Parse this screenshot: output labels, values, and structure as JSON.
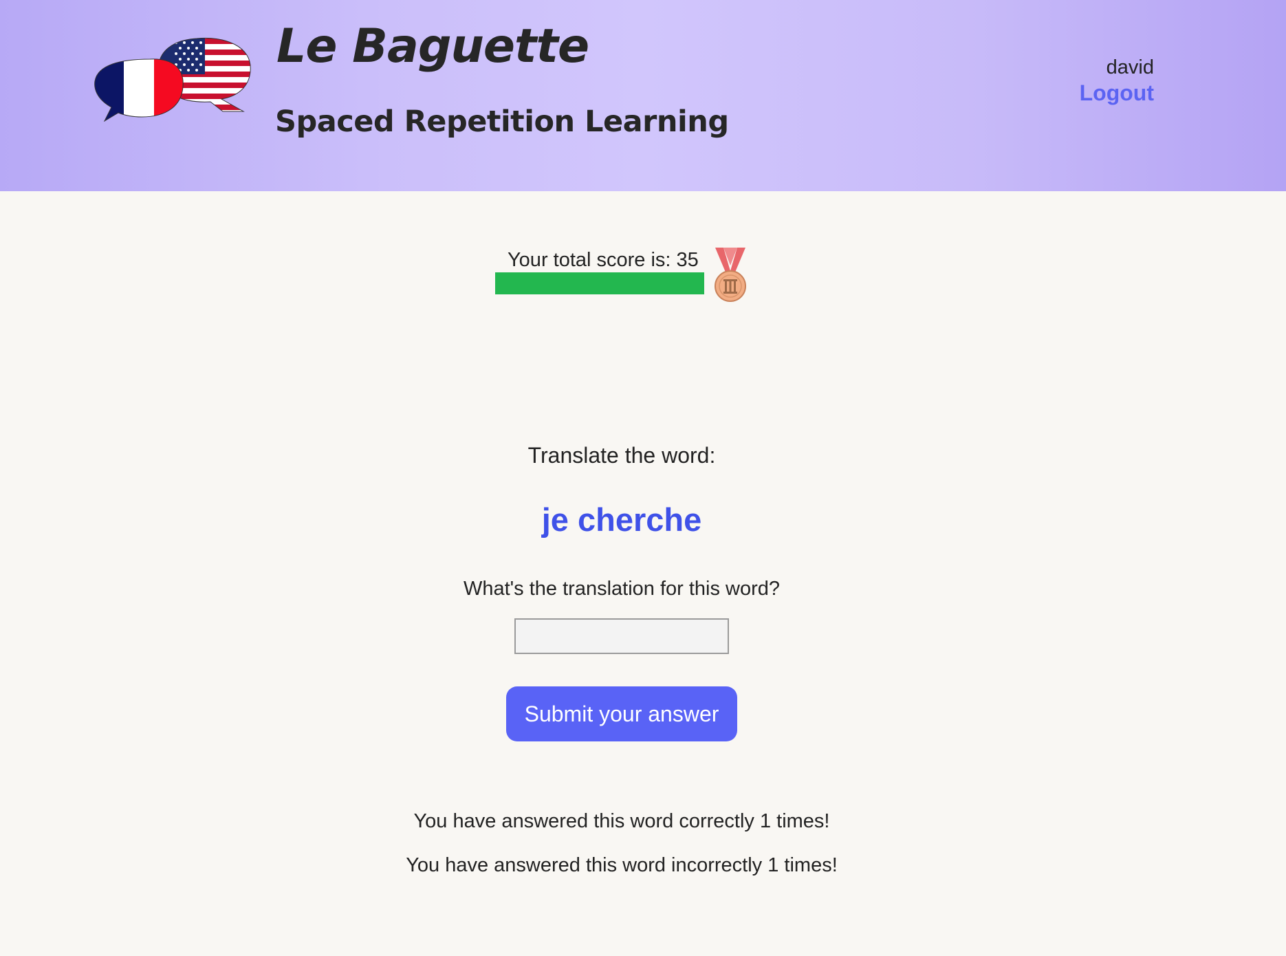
{
  "header": {
    "title": "Le Baguette",
    "subtitle": "Spaced Repetition Learning",
    "logo_icon": "french-american-speech-bubbles-icon",
    "username": "david",
    "logout_label": "Logout"
  },
  "score": {
    "label": "Your total score is: 35",
    "value": 35,
    "progress_fraction": 1.0,
    "progress_color": "#23b74f",
    "medal_icon": "bronze-medal-icon"
  },
  "quiz": {
    "prompt_label": "Translate the word:",
    "word": "je cherche",
    "question": "What's the translation for this word?",
    "answer_value": "",
    "submit_label": "Submit your answer",
    "correct_text": "You have answered this word correctly 1 times!",
    "incorrect_text": "You have answered this word incorrectly 1 times!"
  },
  "colors": {
    "header_gradient_start": "#b7a9f6",
    "header_gradient_mid": "#d1c6fc",
    "accent": "#5963f6",
    "word_color": "#3f51e8",
    "background": "#f9f7f3"
  }
}
